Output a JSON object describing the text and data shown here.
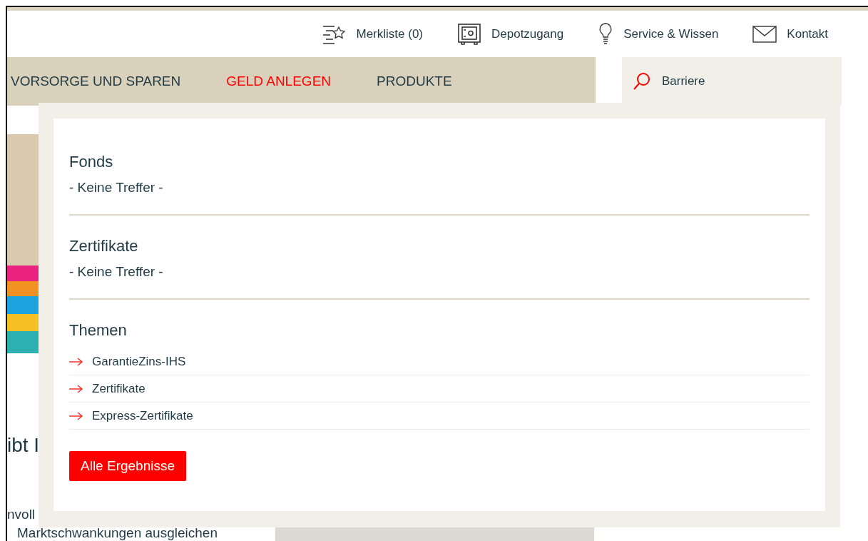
{
  "utility_links": [
    {
      "label": "Merkliste (0)"
    },
    {
      "label": "Depotzugang"
    },
    {
      "label": "Service & Wissen"
    },
    {
      "label": "Kontakt"
    }
  ],
  "nav": [
    {
      "label": "VORSORGE UND SPAREN",
      "selected": false
    },
    {
      "label": "GELD ANLEGEN",
      "selected": true
    },
    {
      "label": "PRODUKTE",
      "selected": false
    }
  ],
  "search": {
    "value": "Barriere"
  },
  "background": {
    "heading_fragment": "ibt I",
    "text_fragments": [
      "nvoll",
      "Marktschwankungen ausgleichen"
    ]
  },
  "results": {
    "sections": [
      {
        "kind": "empty",
        "title": "Fonds",
        "message": "- Keine Treffer -"
      },
      {
        "kind": "empty",
        "title": "Zertifikate",
        "message": "- Keine Treffer -"
      },
      {
        "kind": "links",
        "title": "Themen",
        "links": [
          "GarantieZins-IHS",
          "Zertifikate",
          "Express-Zertifikate"
        ]
      }
    ],
    "button": "Alle Ergebnisse"
  }
}
